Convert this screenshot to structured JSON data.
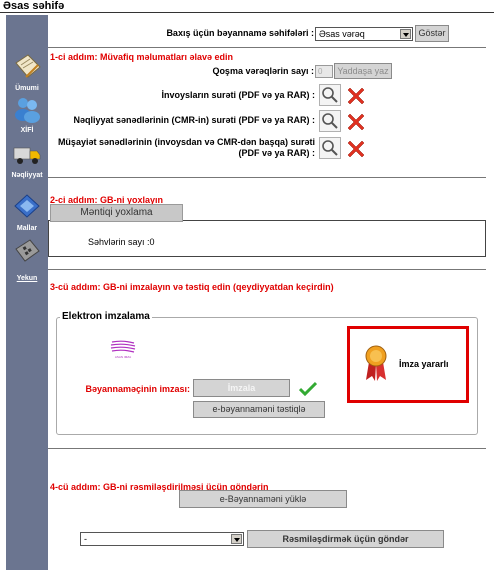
{
  "page": {
    "title": "Əsas səhifə"
  },
  "sidebar": {
    "items": [
      {
        "label": "Ümumi",
        "icon": "document-pen-icon",
        "link": false
      },
      {
        "label": "XİFİ",
        "icon": "people-icon",
        "link": false
      },
      {
        "label": "Nəqliyyat",
        "icon": "truck-icon",
        "link": false
      },
      {
        "label": "Mallar",
        "icon": "goods-icon",
        "link": false
      },
      {
        "label": "Yekun",
        "icon": "calculator-icon",
        "link": true
      }
    ]
  },
  "view": {
    "label": "Baxış üçün bəyannamə səhifələri :",
    "select_value": "Əsas vərəq",
    "show_button": "Göstər"
  },
  "step1": {
    "title": "1-ci addım: Müvafiq məlumatları əlavə edin",
    "attached_label": "Qoşma vərəqlərin sayı :",
    "attached_value": "0",
    "save_button": "Yaddaşa yaz",
    "invoice_label": "İnvoysların surəti (PDF və ya RAR) :",
    "cmr_label": "Nəqliyyat sənədlərinin (CMR-in) surəti (PDF və ya RAR) :",
    "other_label_1": "Müşayiət sənədlərinin (invoysdan və CMR-dən başqa) surəti",
    "other_label_2": "(PDF və ya RAR) :"
  },
  "step2": {
    "title": "2-ci addım: GB-ni yoxlayın",
    "check_button": "Məntiqi yoxlama",
    "errors_label": "Səhvlərin sayı :",
    "errors_value": "0"
  },
  "step3": {
    "title": "3-cü addım: GB-ni imzalayın və təstiq edin (qeydiyyatdan keçirdin)",
    "legend": "Elektron imzalama",
    "asan_logo_text": "ASAN IMZA",
    "signature_label": "Bəyannaməçinin imzası:",
    "sign_button": "İmzala",
    "confirm_button": "e-bəyannaməni təstiqlə",
    "valid_text": "İmza yararlı"
  },
  "step4": {
    "title": "4-cü addım: GB-ni rəsmiləşdirilməsi üçün göndərin",
    "upload_button": "e-Bəyannaməni yüklə",
    "select_value": "-",
    "send_button": "Rəsmiləşdirmək üçün göndər"
  },
  "colors": {
    "step_red": "#e00000",
    "sidebar": "#6b7590",
    "accent_green": "#33aa33"
  }
}
